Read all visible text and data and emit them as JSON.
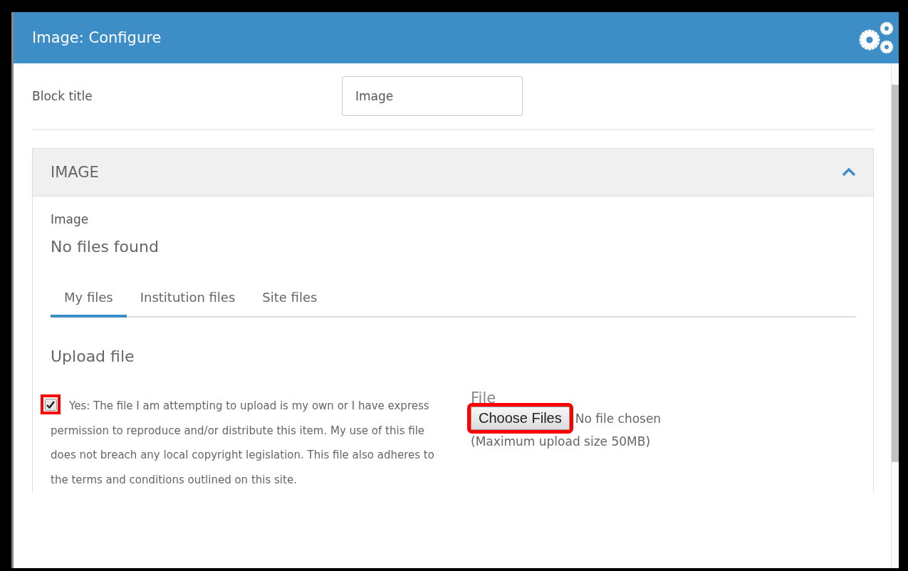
{
  "window": {
    "title": "Image: Configure"
  },
  "block_title": {
    "label": "Block title",
    "value": "Image"
  },
  "section": {
    "title": "IMAGE",
    "expanded": true,
    "image_label": "Image",
    "empty_text": "No files found",
    "tabs": [
      {
        "label": "My files",
        "selected": true
      },
      {
        "label": "Institution files",
        "selected": false
      },
      {
        "label": "Site files",
        "selected": false
      }
    ],
    "upload_heading": "Upload file",
    "consent": {
      "text": "Yes: The file I am attempting to upload is my own or I have express permission to reproduce and/or distribute this item. My use of this file does not breach any local copyright legislation. This file also adheres to the terms and conditions outlined on this site.",
      "checked": true,
      "highlighted": true
    },
    "file": {
      "label": "File",
      "button": "Choose Files",
      "button_highlighted": true,
      "status": "No file chosen",
      "hint": "(Maximum upload size 50MB)"
    }
  }
}
